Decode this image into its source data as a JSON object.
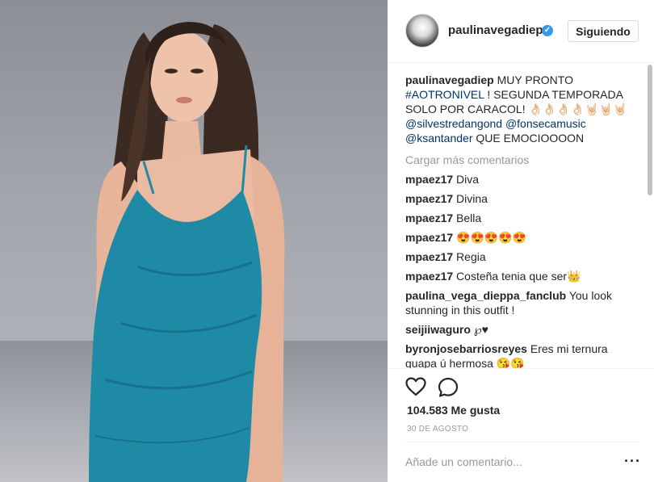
{
  "post": {
    "username": "paulinavegadiep",
    "follow_button": "Siguiendo",
    "caption": {
      "username": "paulinavegadiep",
      "text_1": "MUY PRONTO",
      "hashtag": "#AOTRONIVEL",
      "text_2": "! SEGUNDA TEMPORADA SOLO POR CARACOL! 👌🏻👌🏻👌🏻👌🏻🤘🏻🤘🏻🤘🏻",
      "mention_1": "@silvestredangond",
      "mention_2": "@fonsecamusic",
      "mention_3": "@ksantander",
      "text_3": "QUE EMOCIOOOON"
    },
    "load_more": "Cargar más comentarios",
    "comments": [
      {
        "user": "mpaez17",
        "text": "Diva"
      },
      {
        "user": "mpaez17",
        "text": "Divina"
      },
      {
        "user": "mpaez17",
        "text": "Bella"
      },
      {
        "user": "mpaez17",
        "text": "😍😍😍😍😍"
      },
      {
        "user": "mpaez17",
        "text": "Regia"
      },
      {
        "user": "mpaez17",
        "text": "Costeña tenia que ser👑"
      },
      {
        "user": "paulina_vega_dieppa_fanclub",
        "text": "You look stunning in this outfit !"
      },
      {
        "user": "seijiiwaguro",
        "text": "℘♥"
      },
      {
        "user": "byronjosebarriosreyes",
        "text": "Eres mi ternura guapa ú hermosa 😘😘"
      }
    ],
    "likes": "104.583 Me gusta",
    "date": "30 DE AGOSTO",
    "comment_placeholder": "Añade un comentario...",
    "more_icon": "···",
    "verified_mark": "✓"
  },
  "colors": {
    "link": "#003569",
    "muted": "#999999",
    "verified": "#3897f0",
    "dress": "#1f8aa6"
  },
  "icons": [
    "heart-icon",
    "comment-icon",
    "verified-icon",
    "more-options-icon"
  ]
}
